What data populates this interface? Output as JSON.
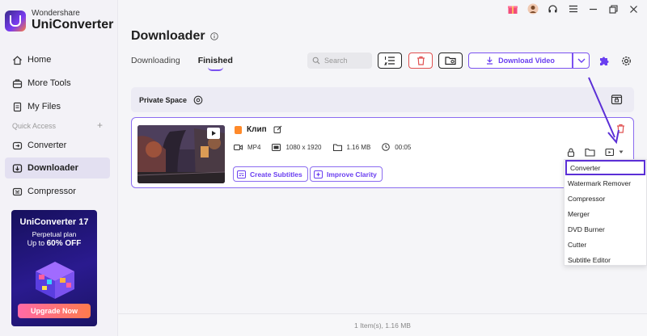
{
  "app": {
    "brand": "Wondershare",
    "product": "UniConverter"
  },
  "sidebar": {
    "items": [
      {
        "label": "Home",
        "icon": "home-icon"
      },
      {
        "label": "More Tools",
        "icon": "toolbox-icon"
      },
      {
        "label": "My Files",
        "icon": "file-icon"
      },
      {
        "label": "Converter",
        "icon": "converter-icon"
      },
      {
        "label": "Downloader",
        "icon": "download-icon",
        "active": true
      },
      {
        "label": "Compressor",
        "icon": "compress-icon"
      }
    ],
    "quick_access_label": "Quick Access",
    "quick_access_add": "+"
  },
  "promo": {
    "title": "UniConverter 17",
    "subtitle": "Perpetual plan",
    "offer_prefix": "Up to",
    "offer_value": "60% OFF",
    "button": "Upgrade Now"
  },
  "header": {
    "title": "Downloader",
    "tabs": [
      {
        "label": "Downloading",
        "active": false
      },
      {
        "label": "Finished",
        "active": true
      }
    ],
    "search_placeholder": "Search",
    "download_button": "Download Video"
  },
  "private_space": {
    "label": "Private Space"
  },
  "item": {
    "title": "Клип",
    "format": "MP4",
    "resolution": "1080 x 1920",
    "size": "1.16 MB",
    "duration": "00:05",
    "create_subtitles": "Create Subtitles",
    "improve_clarity": "Improve Clarity"
  },
  "dropdown": {
    "items": [
      "Converter",
      "Watermark Remover",
      "Compressor",
      "Merger",
      "DVD Burner",
      "Cutter",
      "Subtitle Editor"
    ],
    "selected": "Converter"
  },
  "status": {
    "text": "1 Item(s), 1.16 MB"
  },
  "colors": {
    "accent": "#7b52f0",
    "danger": "#e05050",
    "promo_button": "#ff7070"
  }
}
